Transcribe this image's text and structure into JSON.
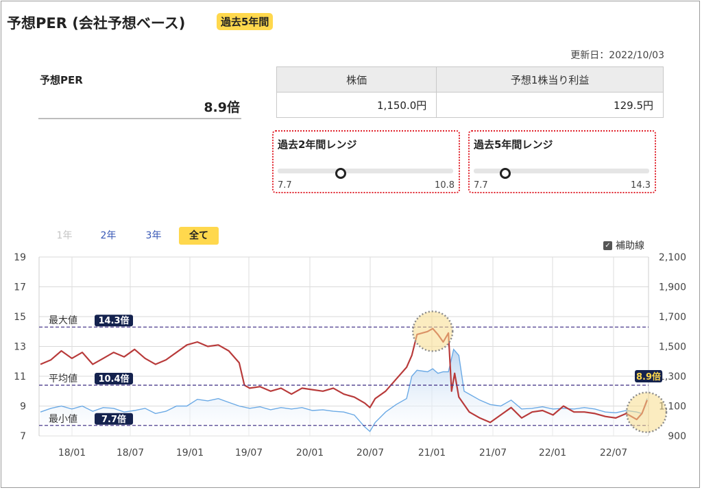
{
  "header": {
    "title": "予想PER (会社予想ベース)",
    "badge": "過去5年間"
  },
  "updated": "更新日：2022/10/03",
  "per": {
    "label": "予想PER",
    "value": "8.9倍"
  },
  "price_table": {
    "headers": [
      "株価",
      "予想1株当り利益"
    ],
    "values": [
      "1,150.0円",
      "129.5円"
    ]
  },
  "ranges": [
    {
      "title": "過去2年間レンジ",
      "min": "7.7",
      "max": "10.8",
      "level": 0.36
    },
    {
      "title": "過去5年間レンジ",
      "min": "7.7",
      "max": "14.3",
      "level": 0.18
    }
  ],
  "tabs": [
    {
      "label": "1年",
      "state": "disabled"
    },
    {
      "label": "2年",
      "state": "link"
    },
    {
      "label": "3年",
      "state": "link"
    },
    {
      "label": "全て",
      "state": "active"
    }
  ],
  "aux_toggle": {
    "label": "補助線",
    "checked": true
  },
  "colors": {
    "per_line": "#b83a3a",
    "price_line": "#6aa9e5",
    "price_fill": "#bcd6f2",
    "badge": "#ffd84d",
    "ref_line": "#4a3a8c",
    "label_bg": "#14224e",
    "range_border": "#e0202a"
  },
  "chart_data": {
    "type": "line",
    "x_ticks": [
      "18/01",
      "18/07",
      "19/01",
      "19/07",
      "20/01",
      "20/07",
      "21/01",
      "21/07",
      "22/01",
      "22/07"
    ],
    "y_left": {
      "ticks": [
        "7",
        "9",
        "11",
        "13",
        "15",
        "17",
        "19"
      ],
      "range": [
        7,
        19
      ]
    },
    "y_right": {
      "ticks": [
        "900",
        "1,100",
        "1,300",
        "1,500",
        "1,700",
        "1,900",
        "2,100"
      ],
      "range": [
        900,
        2100
      ]
    },
    "reference_lines": [
      {
        "label": "最大値",
        "value_label": "14.3倍",
        "value": 14.3
      },
      {
        "label": "平均値",
        "value_label": "10.4倍",
        "value": 10.4
      },
      {
        "label": "最小値",
        "value_label": "7.7倍",
        "value": 7.7
      }
    ],
    "current_label": "8.9倍",
    "current_value": 8.9,
    "x_domain": [
      0,
      58
    ],
    "series": [
      {
        "axis": "left",
        "points": [
          [
            0,
            11.8
          ],
          [
            1,
            12.1
          ],
          [
            2,
            12.7
          ],
          [
            3,
            12.2
          ],
          [
            4,
            12.6
          ],
          [
            5,
            11.8
          ],
          [
            6,
            12.2
          ],
          [
            7,
            12.6
          ],
          [
            8,
            12.3
          ],
          [
            9,
            12.8
          ],
          [
            10,
            12.2
          ],
          [
            11,
            11.8
          ],
          [
            12,
            12.1
          ],
          [
            13,
            12.6
          ],
          [
            14,
            13.1
          ],
          [
            15,
            13.3
          ],
          [
            16,
            13.0
          ],
          [
            17,
            13.1
          ],
          [
            18,
            12.7
          ],
          [
            19,
            11.9
          ],
          [
            19.5,
            10.4
          ],
          [
            20,
            10.2
          ],
          [
            21,
            10.3
          ],
          [
            22,
            10.0
          ],
          [
            23,
            10.2
          ],
          [
            24,
            9.8
          ],
          [
            25,
            10.2
          ],
          [
            26,
            10.1
          ],
          [
            27,
            10.0
          ],
          [
            28,
            10.2
          ],
          [
            29,
            9.8
          ],
          [
            30,
            9.6
          ],
          [
            31,
            9.2
          ],
          [
            31.5,
            8.9
          ],
          [
            32,
            9.5
          ],
          [
            33,
            10.0
          ],
          [
            34,
            10.8
          ],
          [
            35,
            11.6
          ],
          [
            35.5,
            12.4
          ],
          [
            36,
            13.8
          ],
          [
            37,
            14.0
          ],
          [
            37.5,
            14.2
          ],
          [
            38,
            13.8
          ],
          [
            38.5,
            13.3
          ],
          [
            39,
            13.9
          ],
          [
            39.3,
            10.0
          ],
          [
            39.6,
            11.2
          ],
          [
            40,
            9.6
          ],
          [
            41,
            8.6
          ],
          [
            42,
            8.2
          ],
          [
            43,
            7.9
          ],
          [
            44,
            8.4
          ],
          [
            45,
            8.9
          ],
          [
            46,
            8.2
          ],
          [
            47,
            8.6
          ],
          [
            48,
            8.7
          ],
          [
            49,
            8.4
          ],
          [
            50,
            9.0
          ],
          [
            51,
            8.6
          ],
          [
            52,
            8.6
          ],
          [
            53,
            8.5
          ],
          [
            54,
            8.3
          ],
          [
            55,
            8.2
          ],
          [
            56,
            8.5
          ],
          [
            57,
            8.1
          ],
          [
            57.5,
            8.5
          ],
          [
            58,
            9.4
          ]
        ]
      },
      {
        "axis": "right",
        "points": [
          [
            0,
            1060
          ],
          [
            1,
            1085
          ],
          [
            2,
            1100
          ],
          [
            3,
            1080
          ],
          [
            4,
            1100
          ],
          [
            5,
            1065
          ],
          [
            6,
            1090
          ],
          [
            7,
            1085
          ],
          [
            8,
            1060
          ],
          [
            9,
            1070
          ],
          [
            10,
            1085
          ],
          [
            11,
            1050
          ],
          [
            12,
            1065
          ],
          [
            13,
            1100
          ],
          [
            14,
            1100
          ],
          [
            15,
            1145
          ],
          [
            16,
            1135
          ],
          [
            17,
            1150
          ],
          [
            18,
            1125
          ],
          [
            19,
            1100
          ],
          [
            20,
            1085
          ],
          [
            21,
            1095
          ],
          [
            22,
            1075
          ],
          [
            23,
            1090
          ],
          [
            24,
            1080
          ],
          [
            25,
            1090
          ],
          [
            26,
            1070
          ],
          [
            27,
            1075
          ],
          [
            28,
            1065
          ],
          [
            29,
            1060
          ],
          [
            30,
            1040
          ],
          [
            31,
            960
          ],
          [
            31.5,
            930
          ],
          [
            32,
            990
          ],
          [
            33,
            1060
          ],
          [
            34,
            1110
          ],
          [
            35,
            1150
          ],
          [
            35.5,
            1300
          ],
          [
            36,
            1340
          ],
          [
            37,
            1330
          ],
          [
            37.5,
            1350
          ],
          [
            38,
            1320
          ],
          [
            38.5,
            1330
          ],
          [
            39,
            1330
          ],
          [
            39.5,
            1480
          ],
          [
            40,
            1440
          ],
          [
            40.5,
            1200
          ],
          [
            41,
            1180
          ],
          [
            42,
            1140
          ],
          [
            43,
            1110
          ],
          [
            44,
            1100
          ],
          [
            45,
            1140
          ],
          [
            46,
            1080
          ],
          [
            47,
            1085
          ],
          [
            48,
            1095
          ],
          [
            49,
            1080
          ],
          [
            50,
            1085
          ],
          [
            51,
            1080
          ],
          [
            52,
            1090
          ],
          [
            53,
            1080
          ],
          [
            54,
            1060
          ],
          [
            55,
            1055
          ],
          [
            56,
            1070
          ],
          [
            57,
            1060
          ],
          [
            57.5,
            1050
          ],
          [
            58,
            1150
          ]
        ]
      }
    ]
  }
}
